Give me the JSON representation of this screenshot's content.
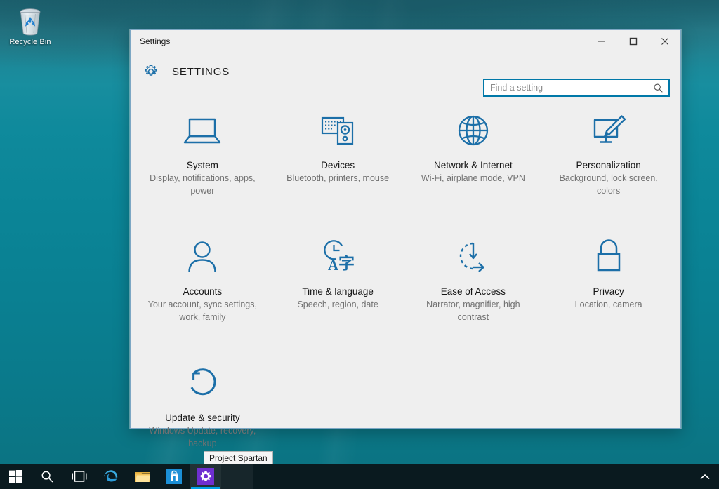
{
  "desktop": {
    "icons": [
      {
        "name": "Recycle Bin",
        "icon": "recycle-bin-icon"
      }
    ],
    "wallpaper_colors": {
      "top": "#1f6b78",
      "mid": "#0b8597",
      "bottom": "#0c7181"
    }
  },
  "window": {
    "title": "Settings",
    "heading": "SETTINGS",
    "gear_icon": "gear-icon",
    "accent": "#0078a8",
    "panel_bg": "#efefef",
    "controls": {
      "minimize": "minimize-icon",
      "maximize": "maximize-icon",
      "close": "close-icon"
    }
  },
  "search": {
    "placeholder": "Find a setting",
    "value": "",
    "icon": "search-icon"
  },
  "tiles": [
    {
      "title": "System",
      "desc": "Display, notifications, apps, power",
      "icon": "laptop-icon"
    },
    {
      "title": "Devices",
      "desc": "Bluetooth, printers, mouse",
      "icon": "keyboard-device-icon"
    },
    {
      "title": "Network & Internet",
      "desc": "Wi-Fi, airplane mode, VPN",
      "icon": "globe-icon"
    },
    {
      "title": "Personalization",
      "desc": "Background, lock screen, colors",
      "icon": "monitor-brush-icon"
    },
    {
      "title": "Accounts",
      "desc": "Your account, sync settings, work, family",
      "icon": "person-icon"
    },
    {
      "title": "Time & language",
      "desc": "Speech, region, date",
      "icon": "clock-language-icon"
    },
    {
      "title": "Ease of Access",
      "desc": "Narrator, magnifier, high contrast",
      "icon": "ease-of-access-icon"
    },
    {
      "title": "Privacy",
      "desc": "Location, camera",
      "icon": "lock-icon"
    },
    {
      "title": "Update & security",
      "desc": "Windows Update, recovery, backup",
      "icon": "refresh-circle-icon"
    }
  ],
  "tooltip": {
    "text": "Project Spartan"
  },
  "taskbar": {
    "bg": "#0a1a1f",
    "items": [
      {
        "name": "start-button",
        "icon": "windows-logo-icon",
        "label": "Start"
      },
      {
        "name": "search-button",
        "icon": "search-icon",
        "label": "Search"
      },
      {
        "name": "task-view-button",
        "icon": "task-view-icon",
        "label": "Task View"
      },
      {
        "name": "edge-button",
        "icon": "edge-icon",
        "label": "Project Spartan"
      },
      {
        "name": "file-explorer-button",
        "icon": "folder-icon",
        "label": "File Explorer"
      },
      {
        "name": "store-button",
        "icon": "store-icon",
        "label": "Store"
      },
      {
        "name": "settings-button",
        "icon": "gear-icon",
        "label": "Settings",
        "active": true
      }
    ],
    "tray": {
      "chevron": "chevron-up-icon"
    }
  }
}
